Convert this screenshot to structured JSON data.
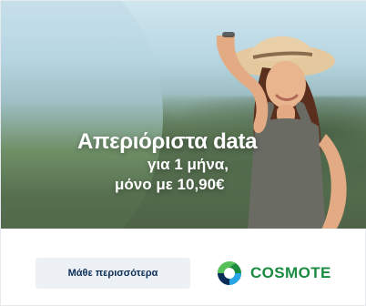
{
  "headline": {
    "line1": "Απεριόριστα data",
    "line2": "για 1 μήνα,",
    "line3": "μόνο με 10,90€"
  },
  "cta": {
    "label": "Μάθε περισσότερα"
  },
  "brand": {
    "name": "COSMOTE"
  },
  "colors": {
    "accent_blue": "#2aa6e6",
    "brand_green": "#1a8b3f",
    "cta_bg": "#edf0f4",
    "cta_text": "#0b2e59"
  },
  "icons": {
    "brand_logo": "cosmote-logo-icon"
  }
}
